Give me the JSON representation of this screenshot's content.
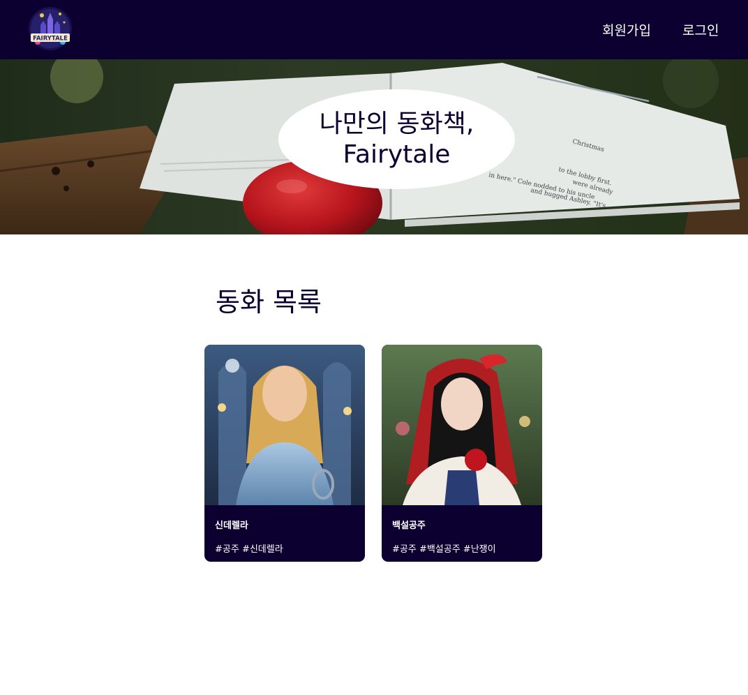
{
  "header": {
    "logo_text": "FAIRYTALE",
    "nav": {
      "signup_label": "회원가입",
      "login_label": "로그인"
    }
  },
  "hero": {
    "title_line1": "나만의 동화책,",
    "title_line2": "Fairytale",
    "book_text": [
      "to the lobby first.",
      "Christmas",
      "were already",
      "in here.\" Cole nodded to his uncle",
      "and hugged Ashley. \"It's"
    ]
  },
  "section": {
    "title": "동화 목록"
  },
  "stories": [
    {
      "title": "신데렐라",
      "tags": "#공주 #신데렐라"
    },
    {
      "title": "백설공주",
      "tags": "#공주 #백설공주 #난쟁이"
    }
  ],
  "colors": {
    "navy": "#0c0030",
    "white": "#ffffff",
    "apple_red": "#b5141c"
  }
}
